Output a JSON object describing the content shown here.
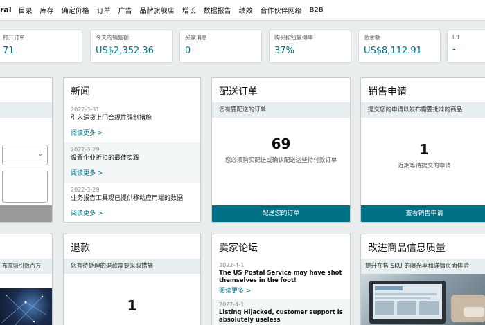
{
  "nav": {
    "brand": "ral",
    "items": [
      "目录",
      "库存",
      "确定价格",
      "订单",
      "广告",
      "品牌旗舰店",
      "增长",
      "数据报告",
      "绩效",
      "合作伙伴网络",
      "B2B"
    ]
  },
  "metrics": [
    {
      "label": "打开订单",
      "value": "71"
    },
    {
      "label": "今天的销售额",
      "value": "US$2,352.36"
    },
    {
      "label": "买家消息",
      "value": "0"
    },
    {
      "label": "购买按钮赢得率",
      "value": "37%"
    },
    {
      "label": "总余额",
      "value": "US$8,112.91"
    },
    {
      "label": "IPI",
      "value": "-"
    }
  ],
  "news": {
    "title": "新闻",
    "items": [
      {
        "date": "2022-3-31",
        "title": "引入送货上门合规性强制措施",
        "more": "阅读更多 >"
      },
      {
        "date": "2022-3-29",
        "title": "设置企业折扣的最佳实践",
        "more": "阅读更多 >"
      },
      {
        "date": "2022-3-29",
        "title": "业务报告工具现已提供移动应用端的数据",
        "more": "阅读更多 >"
      }
    ]
  },
  "shipping": {
    "title": "配送订单",
    "subtitle": "您有要配送的订单",
    "count": "69",
    "desc": "您必须购买配送或确认配送这些待付款订单",
    "footer": "配送您的订单"
  },
  "sales_request": {
    "title": "销售申请",
    "subtitle": "提交您的申请以发布需要批准的商品",
    "count": "1",
    "desc": "近期等待提交的申请",
    "footer": "查看销售申请"
  },
  "refund": {
    "title": "退款",
    "subtitle": "您有待处理的退款需要采取措施",
    "count": "1"
  },
  "forum": {
    "title": "卖家论坛",
    "items": [
      {
        "date": "2022-4-1",
        "title": "The US Postal Service may have shot themselves in the foot!",
        "more": "阅读更多 >"
      },
      {
        "date": "2022-4-1",
        "title": "Listing Hijacked, customer support is absolutely useless"
      }
    ]
  },
  "listing_quality": {
    "title": "改进商品信息质量",
    "subtitle": "提升在售 SKU 的曝光率和详情页面体验"
  },
  "left_partial": {
    "text": "布来吸引数百万"
  },
  "colors": {
    "accent": "#007185",
    "subheader_bg": "#e8eff1",
    "page_bg": "#eaeded"
  }
}
